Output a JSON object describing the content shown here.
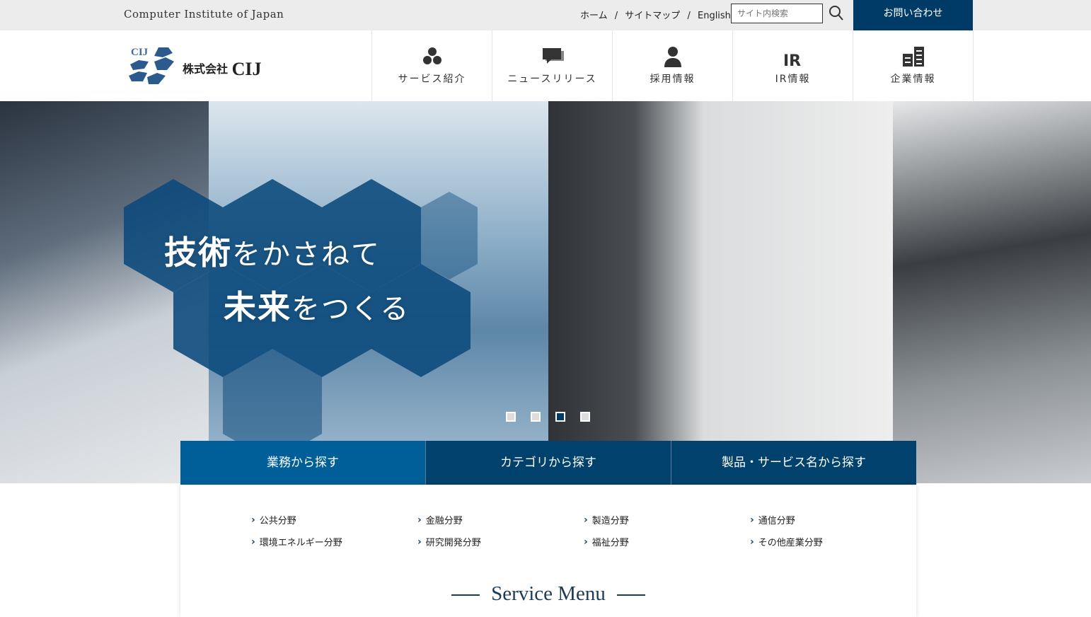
{
  "topbar": {
    "tagline": "Computer Institute of Japan",
    "links": [
      "ホーム",
      "サイトマップ",
      "English"
    ],
    "separator": "/",
    "search_placeholder": "サイト内検索",
    "contact": "お問い合わせ"
  },
  "header": {
    "logo_mark": "CIJ",
    "company_prefix": "株式会社",
    "company_name": "CIJ",
    "nav": [
      {
        "label": "サービス紹介",
        "icon": "hexagons-icon"
      },
      {
        "label": "ニュースリリース",
        "icon": "chat-bubble-icon"
      },
      {
        "label": "採用情報",
        "icon": "person-icon"
      },
      {
        "label": "IR情報",
        "icon": "ir-icon"
      },
      {
        "label": "企業情報",
        "icon": "building-icon"
      }
    ]
  },
  "hero": {
    "line1_kanji": "技術",
    "line1_kana": "をかさねて",
    "line2_kanji": "未来",
    "line2_kana": "をつくる",
    "slides": 4,
    "active_slide": 3
  },
  "tabs": [
    "業務から探す",
    "カテゴリから探す",
    "製品・サービス名から探す"
  ],
  "active_tab": 0,
  "fields": [
    "公共分野",
    "金融分野",
    "製造分野",
    "通信分野",
    "環境エネルギー分野",
    "研究開発分野",
    "福祉分野",
    "その他産業分野"
  ],
  "section_title": "Service Menu",
  "colors": {
    "primary": "#003b68",
    "active_tab": "#005f99"
  }
}
